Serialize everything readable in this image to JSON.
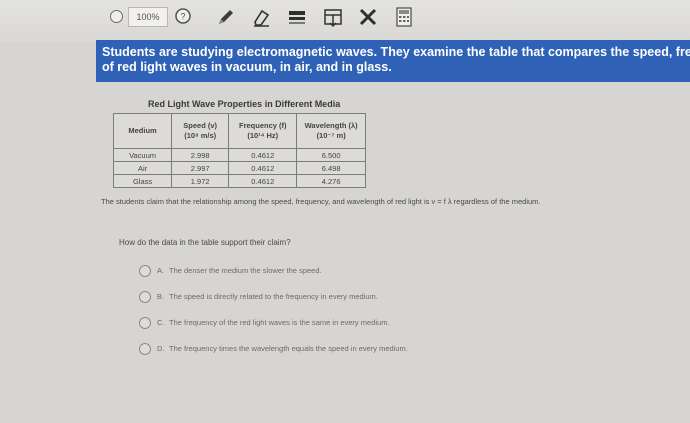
{
  "toolbar": {
    "zoom": "100%",
    "icons": [
      "back-icon",
      "zoom-field",
      "help-icon",
      "pencil-icon",
      "eraser-icon",
      "highlighter-icon",
      "line-reader-icon",
      "eliminate-icon",
      "calculator-icon"
    ]
  },
  "question": {
    "banner_line1": "Students are studying electromagnetic waves. They examine the table that compares the speed, frequency, and wavelength",
    "banner_line2": "of red light waves in vacuum, in air, and in glass.",
    "claim": "The students claim that the relationship among the speed, frequency, and wavelength of red light is v = f λ regardless of the medium.",
    "prompt": "How do the data in the table support their claim?"
  },
  "table": {
    "title": "Red Light Wave Properties in Different Media",
    "headers": {
      "medium": "Medium",
      "speed": "Speed (v)",
      "speed_unit": "(10⁸ m/s)",
      "frequency": "Frequency (f)",
      "frequency_unit": "(10¹⁴ Hz)",
      "wavelength": "Wavelength (λ)",
      "wavelength_unit": "(10⁻⁷ m)"
    },
    "rows": [
      {
        "medium": "Vacuum",
        "speed": "2.998",
        "frequency": "0.4612",
        "wavelength": "6.500"
      },
      {
        "medium": "Air",
        "speed": "2.997",
        "frequency": "0.4612",
        "wavelength": "6.498"
      },
      {
        "medium": "Glass",
        "speed": "1.972",
        "frequency": "0.4612",
        "wavelength": "4.276"
      }
    ]
  },
  "choices": [
    {
      "letter": "A.",
      "text": "The denser the medium the slower the speed."
    },
    {
      "letter": "B.",
      "text": "The speed is directly related to the frequency in every medium."
    },
    {
      "letter": "C.",
      "text": "The frequency of the red light waves is the same in every medium."
    },
    {
      "letter": "D.",
      "text": "The frequency times the wavelength equals the speed in every medium."
    }
  ]
}
